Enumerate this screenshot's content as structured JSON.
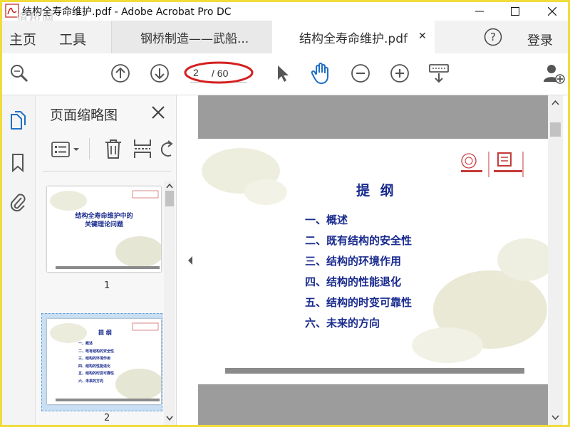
{
  "window": {
    "title": "结构全寿命维护.pdf - Adobe Acrobat Pro DC",
    "watermark": "道桥网"
  },
  "menu": {
    "home": "主页",
    "tools": "工具"
  },
  "tabs": [
    {
      "label": "钢桥制造——武船...",
      "active": false
    },
    {
      "label": "结构全寿命维护.pdf",
      "active": true
    }
  ],
  "header_right": {
    "help_icon": "help-icon",
    "login": "登录"
  },
  "toolbar": {
    "current_page": "2",
    "total_pages": "/ 60"
  },
  "colors": {
    "accent_blue": "#1f6fc5",
    "slide_text": "#1a2b8f",
    "annotation_red": "#d42020"
  },
  "panel": {
    "title": "页面缩略图",
    "thumbnails": [
      {
        "number": "1",
        "title_line1": "结构全寿命维护中的",
        "title_line2": "关键理论问题"
      },
      {
        "number": "2",
        "title": "提 纲"
      }
    ]
  },
  "slide": {
    "title": "提 纲",
    "items": [
      "一、概述",
      "二、既有结构的安全性",
      "三、结构的环境作用",
      "四、结构的性能退化",
      "五、结构的时变可靠性",
      "六、未来的方向"
    ]
  }
}
